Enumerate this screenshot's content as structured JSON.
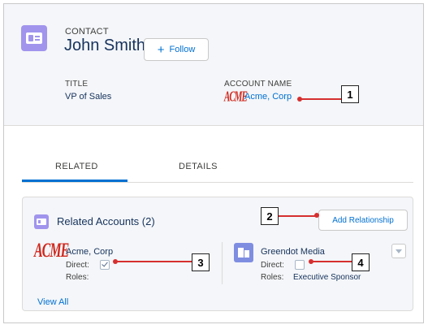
{
  "header": {
    "object_label": "CONTACT",
    "record_name": "John Smith",
    "follow_label": "Follow",
    "follow_icon": "plus-icon"
  },
  "fields": {
    "title_label": "TITLE",
    "title_value": "VP of Sales",
    "account_label": "ACCOUNT NAME",
    "account_value": "Acme, Corp",
    "account_logo": "ACME"
  },
  "tabs": [
    {
      "label": "RELATED",
      "active": true
    },
    {
      "label": "DETAILS",
      "active": false
    }
  ],
  "related_accounts": {
    "title": "Related Accounts (2)",
    "add_button": "Add Relationship",
    "view_all": "View All",
    "items": [
      {
        "logo": "ACME",
        "name": "Acme, Corp",
        "direct_label": "Direct:",
        "direct_checked": true,
        "roles_label": "Roles:",
        "roles_value": ""
      },
      {
        "logo": "building-icon",
        "name": "Greendot Media",
        "direct_label": "Direct:",
        "direct_checked": false,
        "roles_label": "Roles:",
        "roles_value": "Executive Sponsor"
      }
    ]
  },
  "callouts": [
    "1",
    "2",
    "3",
    "4"
  ],
  "colors": {
    "accent": "#0070d2",
    "contact_icon": "#a094ed",
    "callout_line": "#d62f2f",
    "acme_red": "#d0271d"
  }
}
